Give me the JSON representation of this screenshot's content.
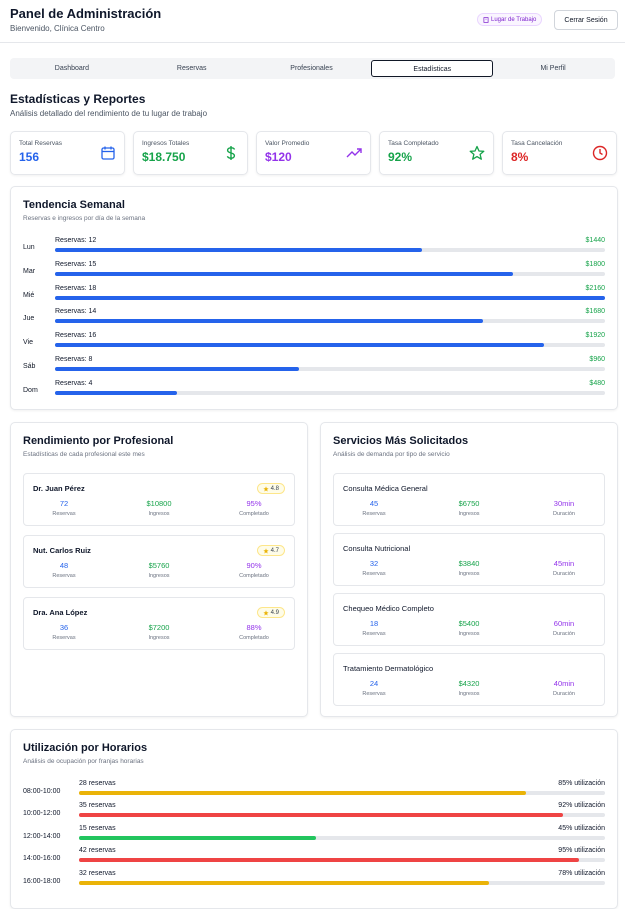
{
  "header": {
    "title": "Panel de Administración",
    "subtitle": "Bienvenido, Clínica Centro",
    "badge": "Lugar de Trabajo",
    "logout": "Cerrar Sesión"
  },
  "tabs": [
    {
      "label": "Dashboard"
    },
    {
      "label": "Reservas"
    },
    {
      "label": "Profesionales"
    },
    {
      "label": "Estadísticas",
      "active": true
    },
    {
      "label": "Mi Perfil"
    }
  ],
  "section": {
    "title": "Estadísticas y Reportes",
    "subtitle": "Análisis detallado del rendimiento de tu lugar de trabajo"
  },
  "stats": [
    {
      "label": "Total Reservas",
      "value": "156",
      "color": "#2563eb",
      "icon": "calendar-icon"
    },
    {
      "label": "Ingresos Totales",
      "value": "$18.750",
      "color": "#16a34a",
      "icon": "dollar-icon"
    },
    {
      "label": "Valor Promedio",
      "value": "$120",
      "color": "#9333ea",
      "icon": "trending-up-icon"
    },
    {
      "label": "Tasa Completado",
      "value": "92%",
      "color": "#16a34a",
      "icon": "star-icon"
    },
    {
      "label": "Tasa Cancelación",
      "value": "8%",
      "color": "#dc2626",
      "icon": "clock-icon"
    }
  ],
  "weekly": {
    "title": "Tendencia Semanal",
    "subtitle": "Reservas e ingresos por día de la semana",
    "days": [
      {
        "day": "Lun",
        "res": "Reservas: 12",
        "amt": "$1440",
        "count": 12
      },
      {
        "day": "Mar",
        "res": "Reservas: 15",
        "amt": "$1800",
        "count": 15
      },
      {
        "day": "Mié",
        "res": "Reservas: 18",
        "amt": "$2160",
        "count": 18
      },
      {
        "day": "Jue",
        "res": "Reservas: 14",
        "amt": "$1680",
        "count": 14
      },
      {
        "day": "Vie",
        "res": "Reservas: 16",
        "amt": "$1920",
        "count": 16
      },
      {
        "day": "Sáb",
        "res": "Reservas: 8",
        "amt": "$960",
        "count": 8
      },
      {
        "day": "Dom",
        "res": "Reservas: 4",
        "amt": "$480",
        "count": 4
      }
    ],
    "max": 18
  },
  "professionals": {
    "title": "Rendimiento por Profesional",
    "subtitle": "Estadísticas de cada profesional este mes",
    "items": [
      {
        "name": "Dr. Juan Pérez",
        "rating": "4.8",
        "reservas": "72",
        "ingresos": "$10800",
        "completado": "95%"
      },
      {
        "name": "Nut. Carlos Ruiz",
        "rating": "4.7",
        "reservas": "48",
        "ingresos": "$5760",
        "completado": "90%"
      },
      {
        "name": "Dra. Ana López",
        "rating": "4.9",
        "reservas": "36",
        "ingresos": "$7200",
        "completado": "88%"
      }
    ],
    "labels": {
      "reservas": "Reservas",
      "ingresos": "Ingresos",
      "completado": "Completado"
    }
  },
  "services": {
    "title": "Servicios Más Solicitados",
    "subtitle": "Análisis de demanda por tipo de servicio",
    "items": [
      {
        "name": "Consulta Médica General",
        "reservas": "45",
        "ingresos": "$6750",
        "duracion": "30min"
      },
      {
        "name": "Consulta Nutricional",
        "reservas": "32",
        "ingresos": "$3840",
        "duracion": "45min"
      },
      {
        "name": "Chequeo Médico Completo",
        "reservas": "18",
        "ingresos": "$5400",
        "duracion": "60min"
      },
      {
        "name": "Tratamiento Dermatológico",
        "reservas": "24",
        "ingresos": "$4320",
        "duracion": "40min"
      }
    ],
    "labels": {
      "reservas": "Reservas",
      "ingresos": "Ingresos",
      "duracion": "Duración"
    }
  },
  "hours": {
    "title": "Utilización por Horarios",
    "subtitle": "Análisis de ocupación por franjas horarias",
    "items": [
      {
        "range": "08:00-10:00",
        "res": "28 reservas",
        "util": "85% utilización",
        "pct": 85,
        "color": "#eab308"
      },
      {
        "range": "10:00-12:00",
        "res": "35 reservas",
        "util": "92% utilización",
        "pct": 92,
        "color": "#ef4444"
      },
      {
        "range": "12:00-14:00",
        "res": "15 reservas",
        "util": "45% utilización",
        "pct": 45,
        "color": "#22c55e"
      },
      {
        "range": "14:00-16:00",
        "res": "42 reservas",
        "util": "95% utilización",
        "pct": 95,
        "color": "#ef4444"
      },
      {
        "range": "16:00-18:00",
        "res": "32 reservas",
        "util": "78% utilización",
        "pct": 78,
        "color": "#eab308"
      }
    ]
  }
}
